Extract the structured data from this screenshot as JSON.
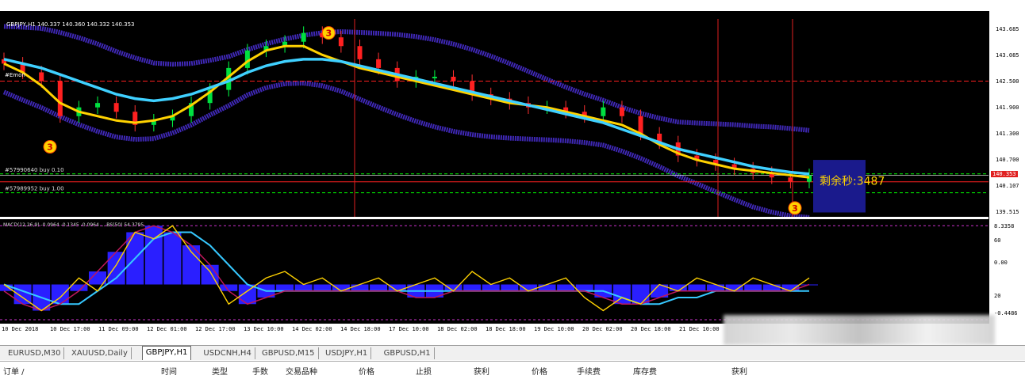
{
  "chart_data": [
    {
      "type": "candlestick",
      "title": "GBPJPY,H1 140.337 140.360 140.332 140.353",
      "price_ticks": [
        "143.685",
        "143.085",
        "142.500",
        "141.900",
        "141.300",
        "140.700",
        "140.107",
        "139.515"
      ],
      "price_range": [
        139.4,
        144.1
      ],
      "current_price_badge": "140.353",
      "orders": [
        {
          "label": "#57990640 buy 0.10",
          "price": 140.38
        },
        {
          "label": "#57989952 buy 1.00",
          "price": 139.95
        }
      ],
      "left_label": "#Emon",
      "countdown_text": "剩余秒:3487",
      "marker_numbers": [
        "3",
        "3",
        "3"
      ],
      "series": [
        {
          "name": "close",
          "values": [
            142.9,
            142.7,
            142.5,
            141.7,
            141.9,
            142.0,
            141.8,
            141.5,
            141.6,
            141.7,
            142.0,
            142.3,
            142.8,
            143.2,
            143.3,
            143.4,
            143.6,
            143.5,
            143.3,
            143.0,
            142.8,
            142.5,
            142.6,
            142.6,
            142.5,
            142.2,
            142.1,
            142.0,
            141.9,
            141.9,
            141.8,
            141.7,
            141.9,
            141.7,
            141.3,
            141.1,
            140.8,
            140.7,
            140.6,
            140.5,
            140.4,
            140.3,
            140.2,
            140.35
          ]
        },
        {
          "name": "ma_fast",
          "values": [
            142.9,
            142.7,
            142.4,
            142.0,
            141.8,
            141.7,
            141.6,
            141.55,
            141.6,
            141.7,
            141.95,
            142.25,
            142.6,
            142.95,
            143.2,
            143.3,
            143.3,
            143.1,
            142.95,
            142.8,
            142.7,
            142.6,
            142.5,
            142.4,
            142.3,
            142.2,
            142.1,
            142.0,
            141.95,
            141.9,
            141.8,
            141.7,
            141.6,
            141.5,
            141.3,
            141.05,
            140.85,
            140.7,
            140.6,
            140.5,
            140.45,
            140.4,
            140.35,
            140.3
          ]
        },
        {
          "name": "ma_slow",
          "values": [
            143.0,
            142.9,
            142.8,
            142.65,
            142.5,
            142.35,
            142.2,
            142.1,
            142.05,
            142.1,
            142.2,
            142.35,
            142.5,
            142.7,
            142.85,
            142.95,
            143.0,
            143.0,
            142.95,
            142.85,
            142.75,
            142.65,
            142.55,
            142.45,
            142.35,
            142.25,
            142.15,
            142.05,
            141.95,
            141.85,
            141.75,
            141.65,
            141.55,
            141.4,
            141.25,
            141.1,
            140.95,
            140.85,
            140.75,
            140.65,
            140.55,
            140.48,
            140.42,
            140.38
          ]
        }
      ]
    },
    {
      "type": "line",
      "title": "MACD(12,26,9) -0.0964 -0.1345 -0.0964 ... BS(50) 54.3795",
      "ticks": [
        "8.3358",
        "60",
        "0.00",
        "20",
        "-0.4486"
      ],
      "series": [
        {
          "name": "histogram",
          "values": [
            -1,
            -3,
            -4,
            -3,
            -1,
            2,
            5,
            8,
            9,
            8,
            6,
            3,
            -1,
            -3,
            -2,
            -1,
            -1,
            -1,
            -1,
            -1,
            -1,
            -1,
            -2,
            -2,
            -1,
            -1,
            -1,
            -1,
            -1,
            -1,
            -1,
            -1,
            -2,
            -3,
            -3,
            -2,
            -1,
            -1,
            -1,
            -1,
            -1,
            -1,
            -1,
            0
          ]
        },
        {
          "name": "signal",
          "values": [
            0,
            -1,
            -2,
            -3,
            -3,
            -1,
            1,
            4,
            7,
            8,
            8,
            6,
            3,
            0,
            -1,
            -1,
            -1,
            -1,
            -1,
            -1,
            -1,
            -1,
            -1,
            -1,
            -1,
            -1,
            -1,
            -1,
            -1,
            -1,
            -1,
            -1,
            -1,
            -2,
            -3,
            -3,
            -2,
            -2,
            -1,
            -1,
            -1,
            -1,
            -1,
            -1
          ]
        },
        {
          "name": "fast",
          "values": [
            0,
            -2,
            -4,
            -2,
            1,
            -1,
            3,
            8,
            7,
            9,
            5,
            2,
            -3,
            -1,
            1,
            2,
            0,
            1,
            -1,
            0,
            1,
            -1,
            0,
            1,
            -1,
            2,
            0,
            1,
            -1,
            0,
            1,
            -2,
            -4,
            -2,
            -3,
            0,
            -1,
            1,
            0,
            -1,
            1,
            0,
            -1,
            1
          ]
        }
      ],
      "range": [
        -6,
        10
      ]
    }
  ],
  "date_labels": [
    "10 Dec 2018",
    "10 Dec 17:00",
    "11 Dec 09:00",
    "12 Dec 01:00",
    "12 Dec 17:00",
    "13 Dec 10:00",
    "14 Dec 02:00",
    "14 Dec 18:00",
    "17 Dec 10:00",
    "18 Dec 02:00",
    "18 Dec 18:00",
    "19 Dec 10:00",
    "20 Dec 02:00",
    "20 Dec 18:00",
    "21 Dec 10:00"
  ],
  "tabs": [
    "EURUSD,M30",
    "XAUUSD,Daily",
    "GBPJPY,H1",
    "USDCNH,H4",
    "GBPUSD,M15",
    "USDJPY,H1",
    "GBPUSD,H1"
  ],
  "active_tab": "GBPJPY,H1",
  "columns": [
    "订单 /",
    "时间",
    "类型",
    "手数",
    "交易品种",
    "价格",
    "止损",
    "获利",
    "价格",
    "手续费",
    "库存费",
    "获利"
  ],
  "colors": {
    "background": "#000000",
    "ma_fast": "#ffd200",
    "ma_slow": "#3fd0ff",
    "band": "#4a2fd6",
    "order_line": "#00ff00",
    "resistance": "#ff2020"
  }
}
